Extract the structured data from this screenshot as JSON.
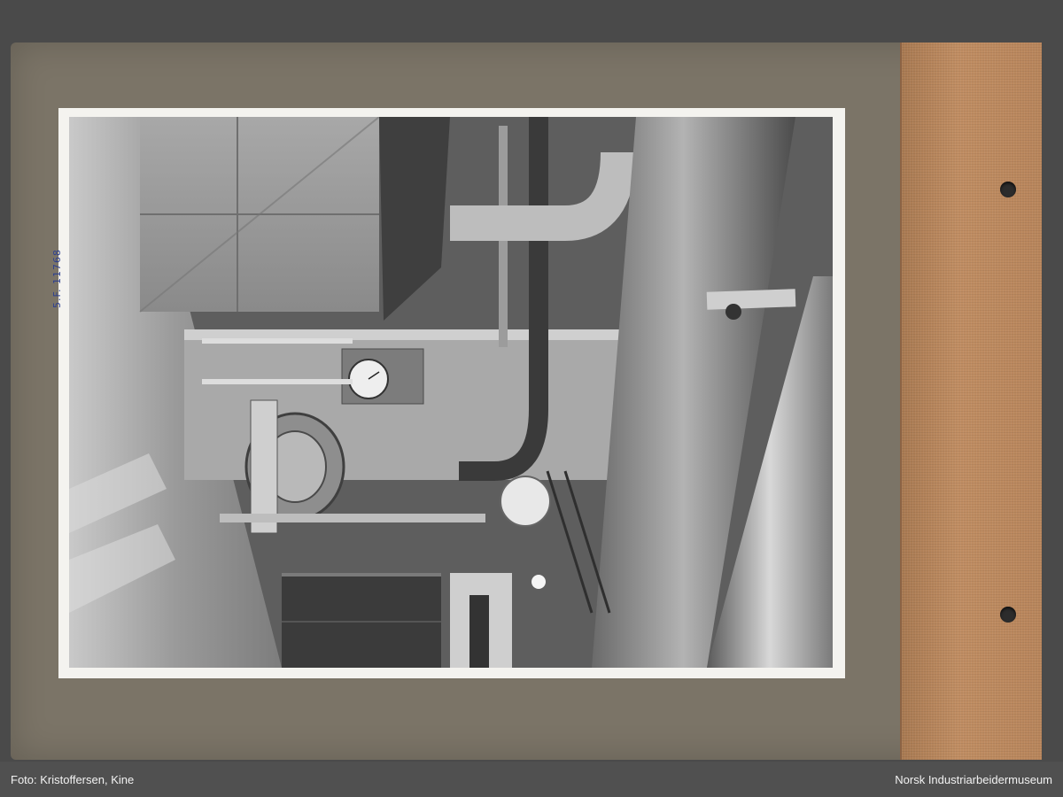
{
  "photo": {
    "inscription": "5.F. 11768",
    "description": "Archive photograph of industrial machinery with large pipes and a gauge"
  },
  "footer": {
    "credit": "Foto: Kristoffersen, Kine",
    "institution": "Norsk Industriarbeidermuseum"
  },
  "colors": {
    "mount": "#7b7467",
    "spine": "#b8855b",
    "footer": "#505050"
  }
}
